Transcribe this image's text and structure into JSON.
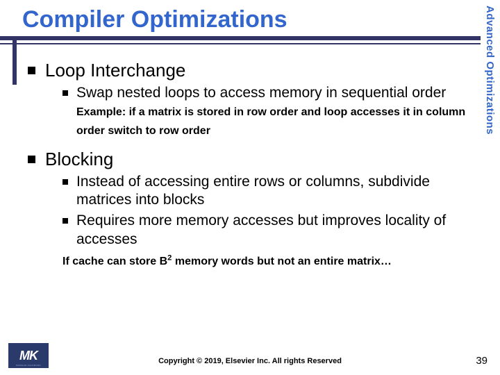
{
  "title": "Compiler Optimizations",
  "sidebar": "Advanced Optimizations",
  "sections": [
    {
      "heading": "Loop Interchange",
      "items": [
        {
          "text": "Swap nested loops to access memory in sequential order",
          "example": "Example: if a matrix is stored in row order and loop accesses it in column order switch to row order"
        }
      ]
    },
    {
      "heading": "Blocking",
      "items": [
        {
          "text": "Instead of accessing entire rows or columns, subdivide matrices into blocks"
        },
        {
          "text": "Requires more memory accesses but improves locality of accesses"
        }
      ],
      "note_prefix": "If cache can store B",
      "note_sup": "2",
      "note_suffix": " memory words but not an entire matrix…"
    }
  ],
  "logo": {
    "main": "MK",
    "sub": "MORGAN KAUFMANN"
  },
  "copyright": "Copyright © 2019, Elsevier Inc. All rights Reserved",
  "page": "39"
}
